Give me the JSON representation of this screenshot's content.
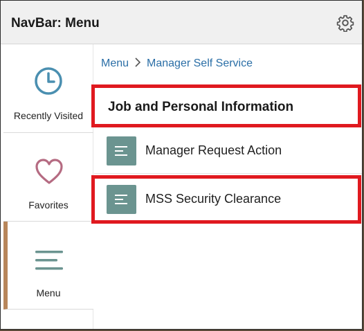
{
  "header": {
    "title": "NavBar: Menu",
    "settings_icon": "gear-icon"
  },
  "sidebar": {
    "items": [
      {
        "label": "Recently Visited",
        "icon": "clock-icon"
      },
      {
        "label": "Favorites",
        "icon": "heart-icon"
      },
      {
        "label": "Menu",
        "icon": "menu-lines-icon"
      }
    ]
  },
  "breadcrumb": {
    "root": "Menu",
    "current": "Manager Self Service"
  },
  "section": {
    "title": "Job and Personal Information"
  },
  "items": [
    {
      "label": "Manager Request Action",
      "icon": "tile-list-icon"
    },
    {
      "label": "MSS Security Clearance",
      "icon": "tile-list-icon"
    }
  ],
  "colors": {
    "accent_teal": "#6b9490",
    "link_blue": "#2a6ea6",
    "heart": "#b56b82",
    "highlight_red": "#e0191f"
  }
}
